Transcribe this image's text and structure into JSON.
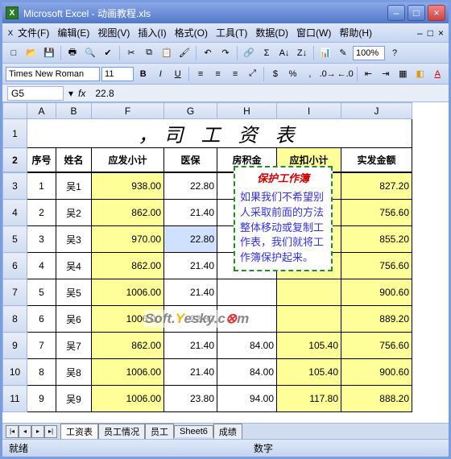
{
  "app": {
    "title": "Microsoft Excel - 动画教程.xls"
  },
  "menu": {
    "file": "文件(F)",
    "edit": "编辑(E)",
    "view": "视图(V)",
    "insert": "插入(I)",
    "format": "格式(O)",
    "tools": "工具(T)",
    "data": "数据(D)",
    "window": "窗口(W)",
    "help": "帮助(H)"
  },
  "toolbar": {
    "zoom": "100%"
  },
  "format": {
    "font": "Times New Roman",
    "size": "11"
  },
  "formula": {
    "ref": "G5",
    "fx": "fx",
    "value": "22.8"
  },
  "columns": {
    "corner": "",
    "A": "A",
    "B": "B",
    "F": "F",
    "G": "G",
    "H": "H",
    "I": "I",
    "J": "J"
  },
  "title_row": "，司 工 资 表",
  "headers": {
    "seq": "序号",
    "name": "姓名",
    "subtotal": "应发小计",
    "med": "医保",
    "fund": "房积金",
    "ded": "应扣小计",
    "net": "实发金额"
  },
  "rows": [
    {
      "n": "1",
      "name": "吴1",
      "f": "938.00",
      "g": "22.80",
      "h": "",
      "i": "",
      "j": "827.20"
    },
    {
      "n": "2",
      "name": "吴2",
      "f": "862.00",
      "g": "21.40",
      "h": "",
      "i": "",
      "j": "756.60"
    },
    {
      "n": "3",
      "name": "吴3",
      "f": "970.00",
      "g": "22.80",
      "h": "",
      "i": "",
      "j": "855.20"
    },
    {
      "n": "4",
      "name": "吴4",
      "f": "862.00",
      "g": "21.40",
      "h": "",
      "i": "",
      "j": "756.60"
    },
    {
      "n": "5",
      "name": "吴5",
      "f": "1006.00",
      "g": "21.40",
      "h": "",
      "i": "",
      "j": "900.60"
    },
    {
      "n": "6",
      "name": "吴6",
      "f": "1006.00",
      "g": "22.80",
      "h": "",
      "i": "",
      "j": "889.20"
    },
    {
      "n": "7",
      "name": "吴7",
      "f": "862.00",
      "g": "21.40",
      "h": "84.00",
      "i": "105.40",
      "j": "756.60"
    },
    {
      "n": "8",
      "name": "吴8",
      "f": "1006.00",
      "g": "21.40",
      "h": "84.00",
      "i": "105.40",
      "j": "900.60"
    },
    {
      "n": "9",
      "name": "吴9",
      "f": "1006.00",
      "g": "23.80",
      "h": "94.00",
      "i": "117.80",
      "j": "888.20"
    }
  ],
  "tabs": {
    "t1": "工资表",
    "t2": "员工情况",
    "t3": "员工",
    "t4": "Sheet6",
    "t5": "成绩"
  },
  "status": {
    "ready": "就绪",
    "right": "数字"
  },
  "tooltip": {
    "title": "保护工作簿",
    "body": "如果我们不希望别人采取前面的方法整体移动或复制工作表，我们就将工作簿保护起来。"
  },
  "watermark": "Soft.Yesky.com"
}
